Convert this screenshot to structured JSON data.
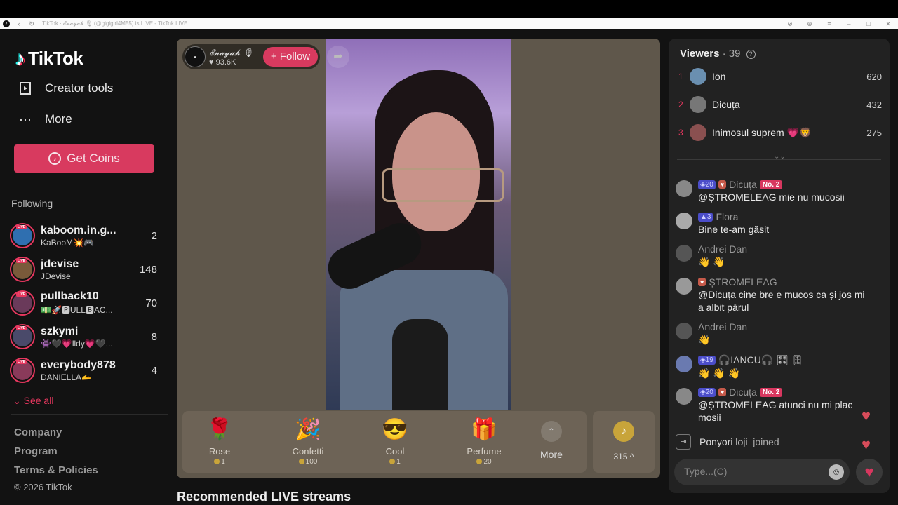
{
  "browser": {
    "title": "TikTok · 𝓔𝓷𝓪𝔂𝓪𝓱 🎙 (@gigigirl4M55) is LIVE - TikTok LIVE"
  },
  "sidebar": {
    "logo": "TikTok",
    "nav": [
      {
        "label": "Creator tools",
        "icon": "creator-tools-icon"
      },
      {
        "label": "More",
        "icon": "more-dots-icon"
      }
    ],
    "get_coins": "Get Coins",
    "following_title": "Following",
    "following": [
      {
        "name": "kaboom.in.g...",
        "sub": "KaBooM💥🎮",
        "count": "2",
        "color": "#2f6fb0"
      },
      {
        "name": "jdevise",
        "sub": "JDevise",
        "count": "148",
        "color": "#7a5a3a"
      },
      {
        "name": "pullback10",
        "sub": "💵🚀🅿ULL🅱AC...",
        "count": "70",
        "color": "#6a3a5a"
      },
      {
        "name": "szkymi",
        "sub": "👾🖤💗lldy💗🖤...",
        "count": "8",
        "color": "#4a4a6a"
      },
      {
        "name": "everybody878",
        "sub": "DANIELLA🫴",
        "count": "4",
        "color": "#8a3a5a"
      }
    ],
    "see_all": "See all",
    "footer": [
      "Company",
      "Program",
      "Terms & Policies"
    ],
    "copyright": "© 2026 TikTok"
  },
  "stream": {
    "host_name": "𝓔𝓷𝓪𝔂𝓪𝓱 🎙",
    "host_likes": "♥ 93.6K",
    "follow_label": "+ Follow",
    "gifts": [
      {
        "name": "Rose",
        "price": "1",
        "icon": "🌹"
      },
      {
        "name": "Confetti",
        "price": "100",
        "icon": "🎉"
      },
      {
        "name": "Cool",
        "price": "1",
        "icon": "😎"
      },
      {
        "name": "Perfume",
        "price": "20",
        "icon": "🎁"
      }
    ],
    "more_label": "More",
    "coin_balance": "315 ^"
  },
  "recommended": "Recommended LIVE streams",
  "viewers": {
    "title": "Viewers",
    "count": "· 39",
    "list": [
      {
        "rank": "1",
        "name": "Ion",
        "score": "620",
        "color": "#6a8fb0"
      },
      {
        "rank": "2",
        "name": "Dicuța",
        "score": "432",
        "color": "#777"
      },
      {
        "rank": "3",
        "name": "Inimosul suprem 💗🦁",
        "score": "275",
        "color": "#8a5050"
      }
    ]
  },
  "chat": [
    {
      "user": "Dicuța",
      "level": "20",
      "fan": "♥",
      "no": "No. 2",
      "text": "@ȘTROMELEAG mie nu mucosii",
      "color": "#888"
    },
    {
      "user": "Flora",
      "level": "3",
      "fan": "",
      "no": "",
      "text": "Bine te-am găsit",
      "color": "#aaa"
    },
    {
      "user": "Andrei Dan",
      "level": "",
      "fan": "",
      "no": "",
      "text": "👋 👋",
      "color": "#555"
    },
    {
      "user": "ȘTROMELEAG",
      "level": "",
      "fan": "♥",
      "no": "",
      "text": "@Dicuța cine bre e mucos ca și jos mi a albit părul",
      "color": "#999"
    },
    {
      "user": "Andrei Dan",
      "level": "",
      "fan": "",
      "no": "",
      "text": "👋",
      "color": "#555"
    },
    {
      "user": "🎧IANCU🎧 🎛 🎚",
      "level": "19",
      "fan": "",
      "no": "",
      "text": "👋 👋 👋",
      "color": "#6a7ab0"
    },
    {
      "user": "Dicuța",
      "level": "20",
      "fan": "♥",
      "no": "No. 2",
      "text": "@ȘTROMELEAG atunci nu mi plac mosii",
      "color": "#888"
    }
  ],
  "joined": {
    "user": "Ponyori loji",
    "text": "joined"
  },
  "chat_input": {
    "placeholder": "Type...(C)"
  }
}
